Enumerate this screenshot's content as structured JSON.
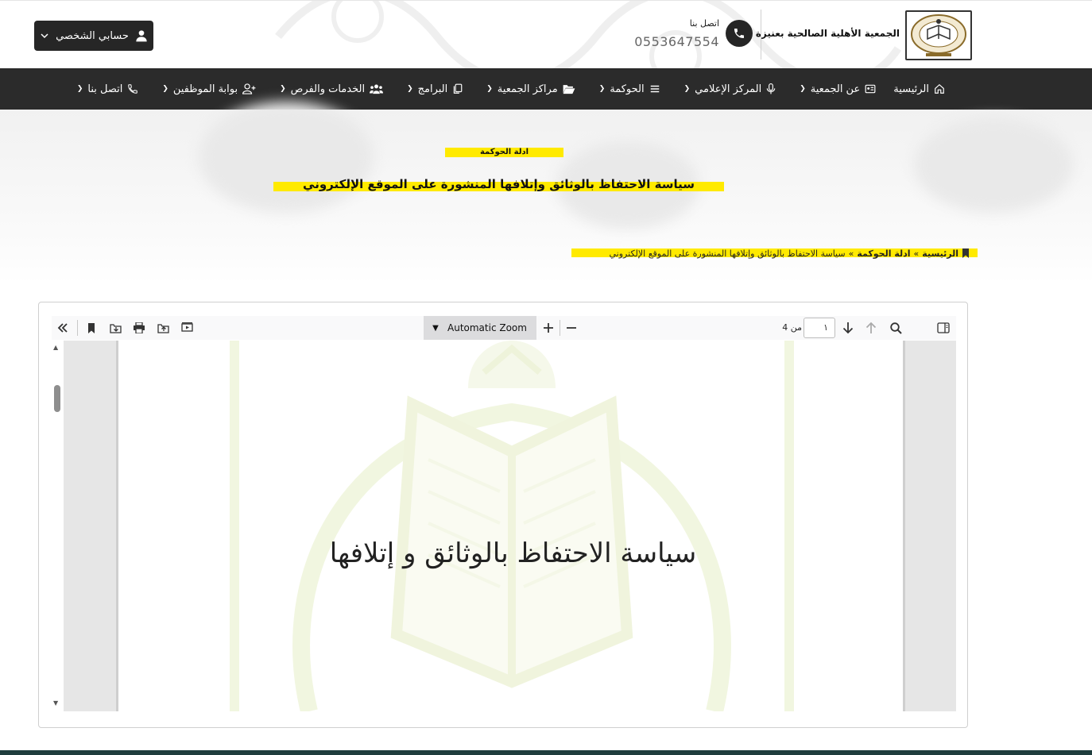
{
  "header": {
    "org_name": "الجمعية الأهلية الصالحية بعنيزة",
    "contact_label": "اتصل بنا",
    "contact_phone": "0553647554",
    "account_label": "حسابي الشخصي"
  },
  "nav": {
    "items": [
      {
        "label": "الرئيسية",
        "icon": "home-icon",
        "has_dropdown": false
      },
      {
        "label": "عن الجمعية",
        "icon": "id-card-icon",
        "has_dropdown": true
      },
      {
        "label": "المركز الإعلامي",
        "icon": "microphone-icon",
        "has_dropdown": true
      },
      {
        "label": "الحوكمة",
        "icon": "list-icon",
        "has_dropdown": true
      },
      {
        "label": "مراكز الجمعية",
        "icon": "folder-open-icon",
        "has_dropdown": true
      },
      {
        "label": "البرامج",
        "icon": "copy-icon",
        "has_dropdown": true
      },
      {
        "label": "الخدمات والفرص",
        "icon": "users-icon",
        "has_dropdown": true
      },
      {
        "label": "بوابة الموظفين",
        "icon": "user-plus-icon",
        "has_dropdown": true
      },
      {
        "label": "اتصل بنا",
        "icon": "phone-icon",
        "has_dropdown": true
      }
    ]
  },
  "hero": {
    "category": "ادلة الحوكمة",
    "title": "سياسة الاحتفاظ بالوثائق وإتلافها المنشورة على الموقع الإلكتروني",
    "breadcrumb": {
      "home": "الرئيسية",
      "separator": "»",
      "section": "ادلة الحوكمة",
      "current": "سياسة الاحتفاظ بالوثائق وإتلافها المنشورة على الموقع الإلكتروني"
    }
  },
  "viewer": {
    "zoom": "Automatic Zoom",
    "page_current": "١",
    "page_of": "من 4",
    "document_text": "سياسة الاحتفاظ بالوثائق و إتلافها"
  },
  "colors": {
    "highlight": "#ffea00",
    "nav_bg": "#2b2b2b",
    "footer": "#1f3d3d"
  }
}
